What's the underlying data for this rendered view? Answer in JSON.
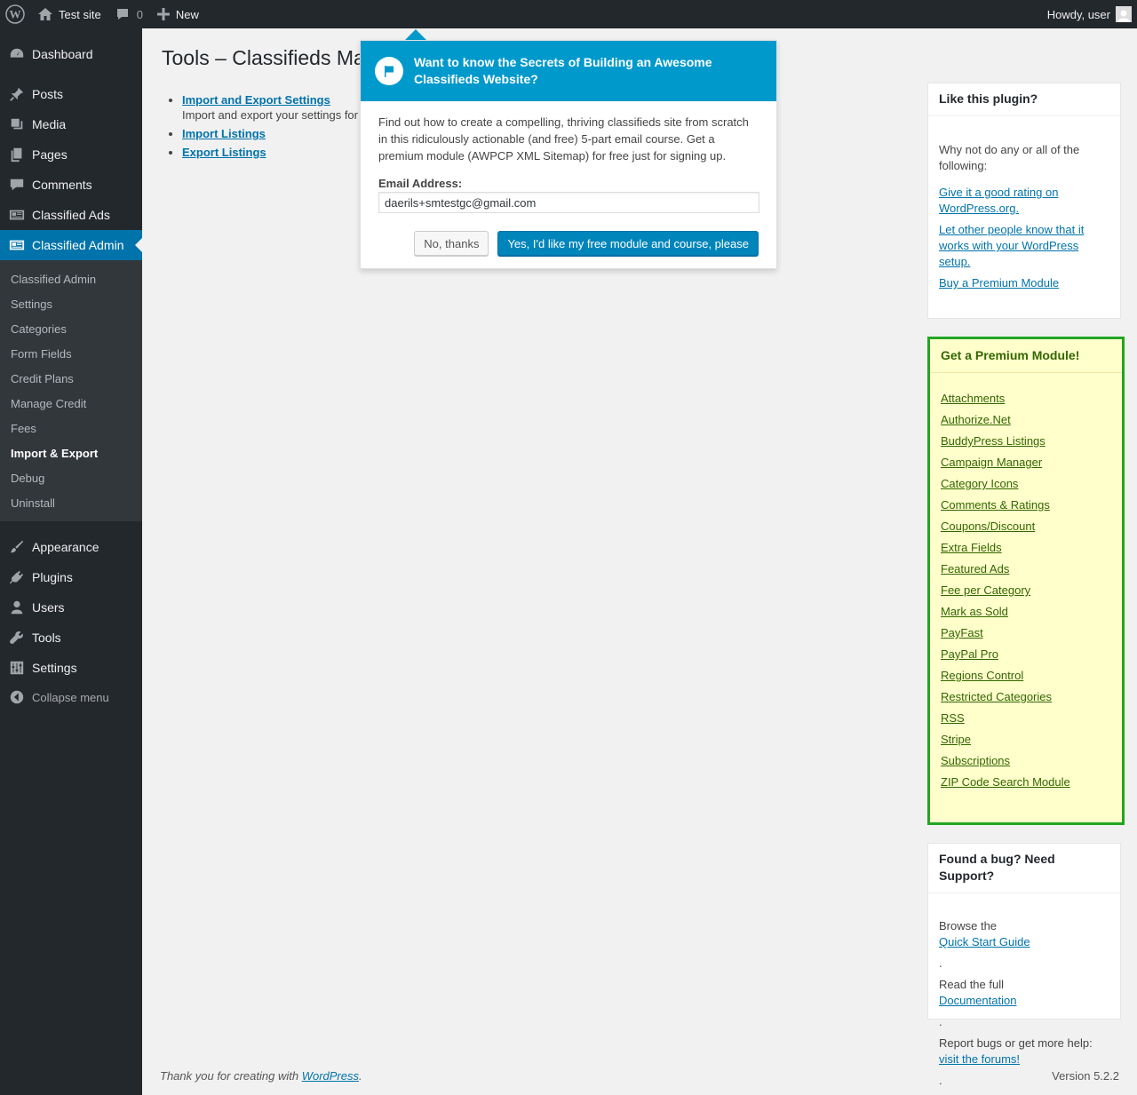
{
  "adminbar": {
    "site_name": "Test site",
    "comments_count": "0",
    "new_label": "New",
    "howdy": "Howdy, user"
  },
  "sidebar": {
    "items_top": [
      {
        "label": "Dashboard",
        "icon": "dashboard-icon"
      },
      {
        "label": "Posts",
        "icon": "pin-icon"
      },
      {
        "label": "Media",
        "icon": "media-icon"
      },
      {
        "label": "Pages",
        "icon": "pages-icon"
      },
      {
        "label": "Comments",
        "icon": "comment-icon"
      },
      {
        "label": "Classified Ads",
        "icon": "classified-icon"
      },
      {
        "label": "Classified Admin",
        "icon": "classified-icon"
      }
    ],
    "submenu": [
      "Classified Admin",
      "Settings",
      "Categories",
      "Form Fields",
      "Credit Plans",
      "Manage Credit",
      "Fees",
      "Import & Export",
      "Debug",
      "Uninstall"
    ],
    "items_bottom": [
      {
        "label": "Appearance",
        "icon": "brush-icon"
      },
      {
        "label": "Plugins",
        "icon": "plug-icon"
      },
      {
        "label": "Users",
        "icon": "user-icon"
      },
      {
        "label": "Tools",
        "icon": "wrench-icon"
      },
      {
        "label": "Settings",
        "icon": "sliders-icon"
      }
    ],
    "collapse": "Collapse menu"
  },
  "main": {
    "title": "Tools – Classifieds Ma",
    "links": [
      {
        "label": "Import and Export Settings",
        "desc": "Import and export your settings for"
      },
      {
        "label": "Import Listings",
        "desc": ""
      },
      {
        "label": "Export Listings",
        "desc": ""
      }
    ]
  },
  "popup": {
    "title": "Want to know the Secrets of Building an Awesome Classifieds Website?",
    "body": "Find out how to create a compelling, thriving classifieds site from scratch in this ridiculously actionable (and free) 5-part email course. Get a premium module (AWPCP XML Sitemap) for free just for signing up.",
    "email_label": "Email Address:",
    "email_value": "daerils+smtestgc@gmail.com",
    "no_label": "No, thanks",
    "yes_label": "Yes, I'd like my free module and course, please"
  },
  "like_box": {
    "title": "Like this plugin?",
    "intro": "Why not do any or all of the following:",
    "links": [
      "Give it a good rating on WordPress.org.",
      "Let other people know that it works with your WordPress setup.",
      "Buy a Premium Module"
    ]
  },
  "premium_box": {
    "title": "Get a Premium Module!",
    "links": [
      "Attachments",
      "Authorize.Net",
      "BuddyPress Listings",
      "Campaign Manager",
      "Category Icons",
      "Comments & Ratings",
      "Coupons/Discount",
      "Extra Fields",
      "Featured Ads",
      "Fee per Category",
      "Mark as Sold",
      "PayFast",
      "PayPal Pro",
      "Regions Control",
      "Restricted Categories",
      "RSS",
      "Stripe",
      "Subscriptions",
      "ZIP Code Search Module"
    ]
  },
  "support_box": {
    "title": "Found a bug? Need Support?",
    "line1_prefix": "Browse the ",
    "line1_link": "Quick Start Guide",
    "line1_suffix": ".",
    "line2_prefix": "Read the full ",
    "line2_link": "Documentation",
    "line2_suffix": ".",
    "line3_prefix": "Report bugs or get more help: ",
    "line3_link": "visit the forums!",
    "line3_suffix": "."
  },
  "footer": {
    "thanks_prefix": "Thank you for creating with ",
    "thanks_link": "WordPress",
    "thanks_suffix": ".",
    "version": "Version 5.2.2"
  }
}
